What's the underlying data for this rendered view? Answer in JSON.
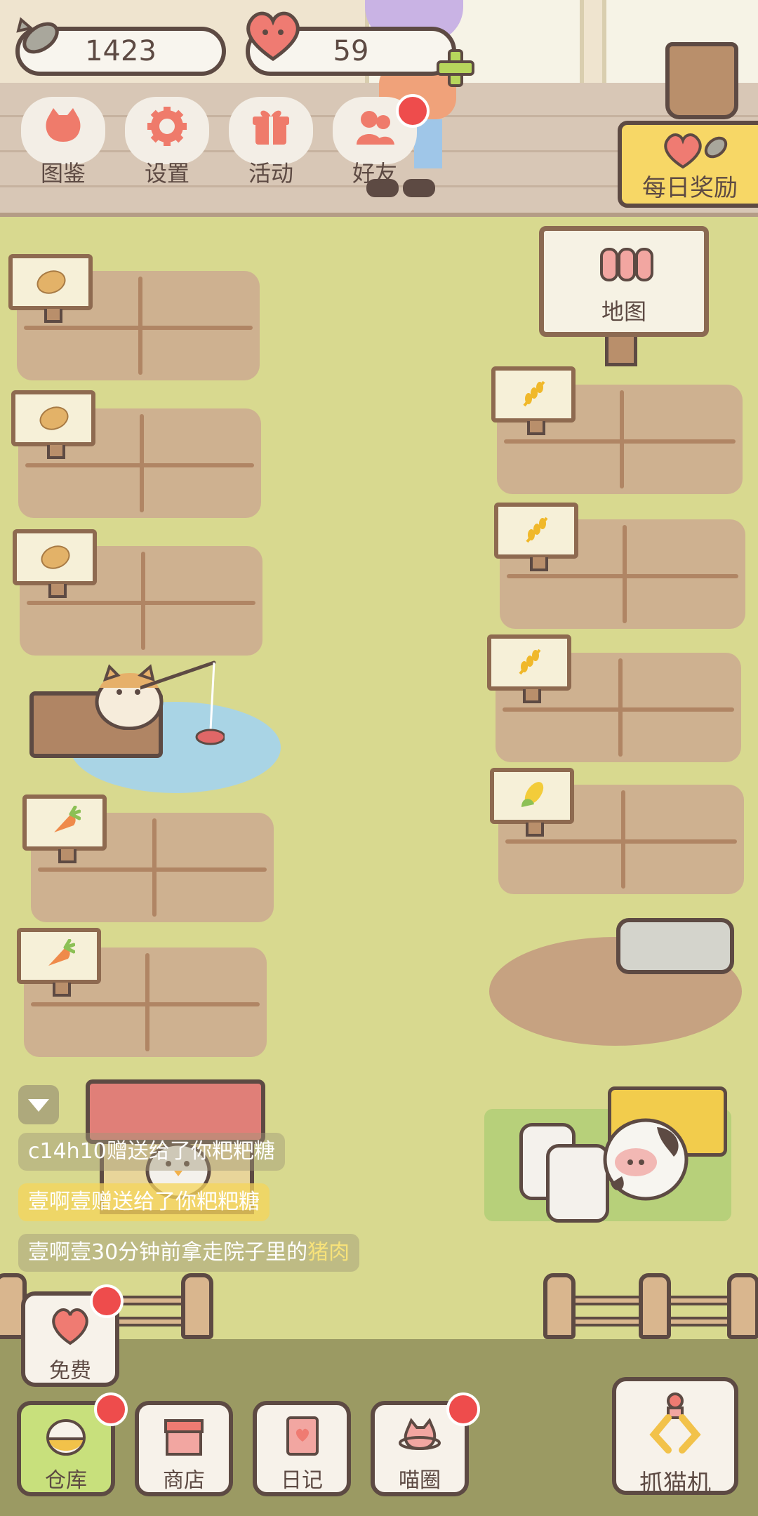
{
  "currency": {
    "fish": {
      "value": "1423",
      "icon": "fish-icon"
    },
    "hearts": {
      "value": "59",
      "icon": "heart-icon"
    }
  },
  "top_menu": [
    {
      "label": "图鉴",
      "icon": "cat-face-icon",
      "color": "#ef7b6b"
    },
    {
      "label": "设置",
      "icon": "gear-icon",
      "color": "#ef7b6b"
    },
    {
      "label": "活动",
      "icon": "gift-icon",
      "color": "#ef7b6b"
    },
    {
      "label": "好友",
      "icon": "friends-icon",
      "color": "#ef7b6b"
    }
  ],
  "daily_reward": {
    "label": "每日奖励"
  },
  "map_sign": {
    "label": "地图"
  },
  "fields_left": [
    {
      "crop": "potato"
    },
    {
      "crop": "potato"
    },
    {
      "crop": "potato"
    },
    {
      "crop": "carrot"
    },
    {
      "crop": "carrot"
    }
  ],
  "fields_right": [
    {
      "crop": "wheat"
    },
    {
      "crop": "wheat"
    },
    {
      "crop": "wheat"
    },
    {
      "crop": "corn"
    }
  ],
  "chat": [
    {
      "prefix": "c14h10赠送给了你",
      "highlight": "粑粑糖",
      "suffix": ""
    },
    {
      "prefix": "壹啊壹赠送给了你",
      "highlight": "粑粑糖",
      "suffix": ""
    },
    {
      "prefix": "壹啊壹30分钟前拿走院子里的",
      "highlight": "猪肉",
      "suffix": ""
    }
  ],
  "free_button": {
    "label": "免费"
  },
  "bottom_nav": [
    {
      "label": "仓库",
      "icon": "egg-icon"
    },
    {
      "label": "商店",
      "icon": "shop-icon"
    },
    {
      "label": "日记",
      "icon": "diary-icon"
    },
    {
      "label": "喵圈",
      "icon": "cat-planet-icon"
    }
  ],
  "claw_machine": {
    "label": "抓猫机"
  },
  "colors": {
    "ground": "#d8d98f",
    "outline": "#5d4a43",
    "accent_red": "#ee4c4c",
    "reward_yellow": "#f7d766",
    "field_soil": "#ceb190"
  }
}
